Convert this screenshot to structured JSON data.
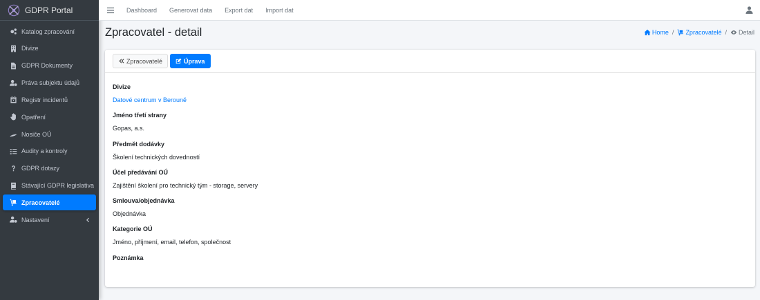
{
  "app": {
    "title": "GDPR Portal"
  },
  "sidebar": {
    "items": [
      {
        "label": "Katalog zpracování",
        "icon": "cogs-icon"
      },
      {
        "label": "Divize",
        "icon": "building-icon"
      },
      {
        "label": "GDPR Dokumenty",
        "icon": "file-icon"
      },
      {
        "label": "Práva subjektu údajů",
        "icon": "user-cog-icon"
      },
      {
        "label": "Registr incidentů",
        "icon": "calendar-times-icon"
      },
      {
        "label": "Opatření",
        "icon": "hand-icon"
      },
      {
        "label": "Nosiče OÚ",
        "icon": "feather-icon"
      },
      {
        "label": "Audity a kontroly",
        "icon": "tasks-icon"
      },
      {
        "label": "GDPR dotazy",
        "icon": "question-icon"
      },
      {
        "label": "Stávající GDPR legislativa",
        "icon": "book-icon"
      },
      {
        "label": "Zpracovatelé",
        "icon": "dolly-icon",
        "active": true
      },
      {
        "label": "Nastavení",
        "icon": "user-cog-icon",
        "has_children": true
      }
    ]
  },
  "topbar": {
    "links": [
      "Dashboard",
      "Generovat data",
      "Export dat",
      "Import dat"
    ]
  },
  "header": {
    "title": "Zpracovatel - detail",
    "breadcrumb": {
      "home": "Home",
      "parent": "Zpracovatelé",
      "current": "Detail"
    }
  },
  "actions": {
    "back_label": "Zpracovatelé",
    "edit_label": "Úprava"
  },
  "fields": [
    {
      "label": "Divize",
      "value": "Datové centrum v Berouně",
      "is_link": true
    },
    {
      "label": "Jméno třetí strany",
      "value": "Gopas, a.s."
    },
    {
      "label": "Předmět dodávky",
      "value": "Školení technických dovedností"
    },
    {
      "label": "Účel předávání OÚ",
      "value": "Zajištění školení pro technický tým - storage, servery"
    },
    {
      "label": "Smlouva/objednávka",
      "value": "Objednávka"
    },
    {
      "label": "Kategorie OÚ",
      "value": "Jméno, příjmení, email, telefon, společnost"
    },
    {
      "label": "Poznámka",
      "value": ""
    }
  ],
  "colors": {
    "primary": "#007bff",
    "sidebar_bg": "#343a40",
    "content_bg": "#f4f6f9"
  }
}
